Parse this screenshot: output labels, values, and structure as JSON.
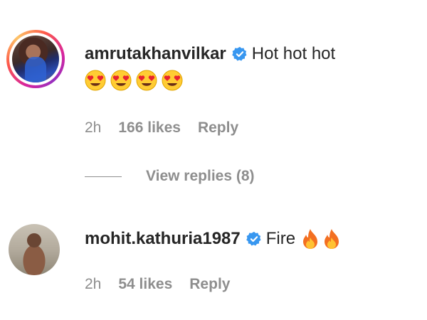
{
  "comments": [
    {
      "username": "amrutakhanvilkar",
      "text": "Hot hot hot",
      "emojis": [
        "heart-eyes-emoji",
        "heart-eyes-emoji",
        "heart-eyes-emoji",
        "heart-eyes-emoji"
      ],
      "time": "2h",
      "likes": "166 likes",
      "reply": "Reply",
      "has_story_ring": true
    },
    {
      "username": "mohit.kathuria1987",
      "text": "Fire",
      "emojis": [
        "fire-emoji",
        "fire-emoji"
      ],
      "time": "2h",
      "likes": "54 likes",
      "reply": "Reply",
      "has_story_ring": false
    }
  ],
  "view_replies": "View replies (8)",
  "colors": {
    "text": "#262626",
    "muted": "#8e8e8e",
    "verified": "#3897f0"
  }
}
